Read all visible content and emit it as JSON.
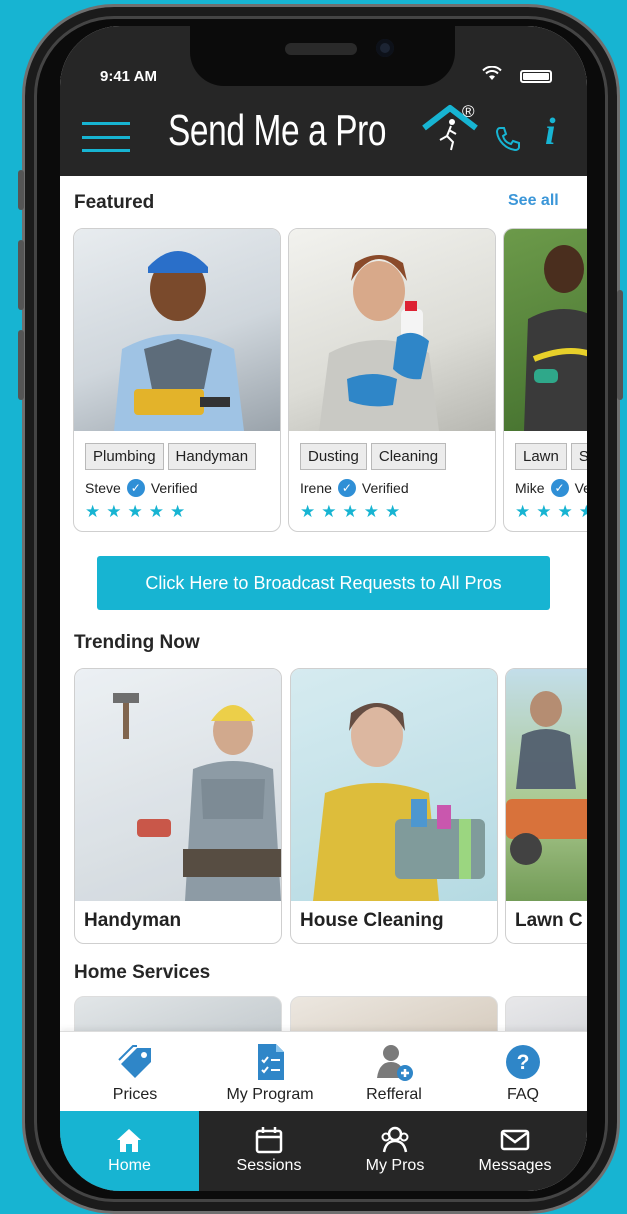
{
  "status_bar": {
    "time": "9:41 AM"
  },
  "header": {
    "logo_text": "Send Me a Pro",
    "registered_mark": "®",
    "info_label": "i"
  },
  "featured": {
    "title": "Featured",
    "see_all": "See all",
    "pros": [
      {
        "tags": [
          "Plumbing",
          "Handyman"
        ],
        "name": "Steve",
        "verified_label": "Verified",
        "rating": 5
      },
      {
        "tags": [
          "Dusting",
          "Cleaning"
        ],
        "name": "Irene",
        "verified_label": "Verified",
        "rating": 5
      },
      {
        "tags": [
          "Lawn",
          "Se"
        ],
        "name": "Mike",
        "verified_label": "Ve",
        "rating": 5
      }
    ]
  },
  "broadcast_button": "Click Here to Broadcast Requests to All Pros",
  "trending": {
    "title": "Trending Now",
    "items": [
      {
        "label": "Handyman"
      },
      {
        "label": "House Cleaning"
      },
      {
        "label": "Lawn C"
      }
    ]
  },
  "home_services": {
    "title": "Home Services"
  },
  "quick_actions": [
    {
      "label": "Prices",
      "icon": "price-tag-icon"
    },
    {
      "label": "My Program",
      "icon": "checklist-icon"
    },
    {
      "label": "Refferal",
      "icon": "add-user-icon"
    },
    {
      "label": "FAQ",
      "icon": "question-icon"
    }
  ],
  "tabs": [
    {
      "label": "Home",
      "icon": "home-icon",
      "active": true
    },
    {
      "label": "Sessions",
      "icon": "calendar-icon",
      "active": false
    },
    {
      "label": "My Pros",
      "icon": "pros-icon",
      "active": false
    },
    {
      "label": "Messages",
      "icon": "envelope-icon",
      "active": false
    }
  ],
  "colors": {
    "accent": "#17b4d2",
    "header_bg": "#262626",
    "link": "#3b96d8"
  }
}
